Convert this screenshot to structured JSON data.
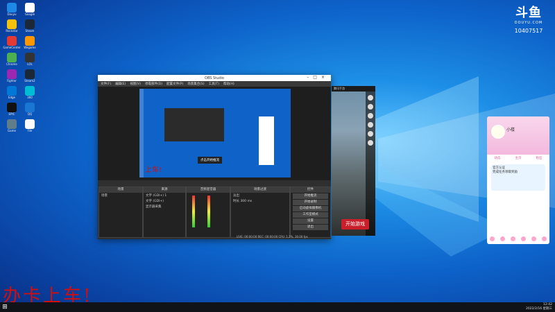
{
  "desktop": {
    "icons": [
      "Douyu",
      "Google",
      "Rockstar",
      "Steam",
      "GameCenter",
      "Wegame",
      "Chrome",
      "LOL",
      "Fighter",
      "Steam2",
      "Edge",
      "360",
      "EPIC",
      "QQ",
      "Game",
      "File"
    ]
  },
  "brand": {
    "logo": "斗鱼",
    "sub": "DOUYU.COM",
    "room_id": "10407517"
  },
  "obs": {
    "title": "OBS Studio",
    "menu": [
      "文件(F)",
      "编辑(E)",
      "视图(V)",
      "停靠部件(D)",
      "配置文件(P)",
      "场景集合(S)",
      "工具(T)",
      "帮助(H)"
    ],
    "scene_header": "场景",
    "scenes": [
      "场景"
    ],
    "sources_header": "来源",
    "sources": [
      "文字 (GDI+) 1",
      "文字 (GDI+)",
      "显示器采集"
    ],
    "mixer_header": "音频混音器",
    "transitions_header": "场景过渡",
    "transition_value": "淡出",
    "duration_label": "时长",
    "duration_value": "300 ms",
    "controls_header": "控件",
    "controls": [
      "开始推流",
      "开始录制",
      "启动虚拟摄像机",
      "工作室模式",
      "设置",
      "退出"
    ],
    "status": "LIVE: 00:00:00   REC: 00:00:00   CPU: 1.2%, 30.00 fps",
    "preview_badge": "点击开始推流",
    "preview_text": "上车!"
  },
  "game": {
    "titlebar": "腾讯手游",
    "start_button": "开始游戏"
  },
  "phone": {
    "name": "小楼",
    "tabs": [
      "动态",
      "主页",
      "粉丝"
    ],
    "card_title": "官方认证",
    "card_text": "完成任务领取奖励"
  },
  "overlay_text": "办卡上车!",
  "taskbar": {
    "time": "12:42",
    "date": "2022/2/16 星期三"
  },
  "colors": {
    "accent": "#c81f2a",
    "obs_bg": "#2b2b2b",
    "desktop": "#0d62c9"
  }
}
